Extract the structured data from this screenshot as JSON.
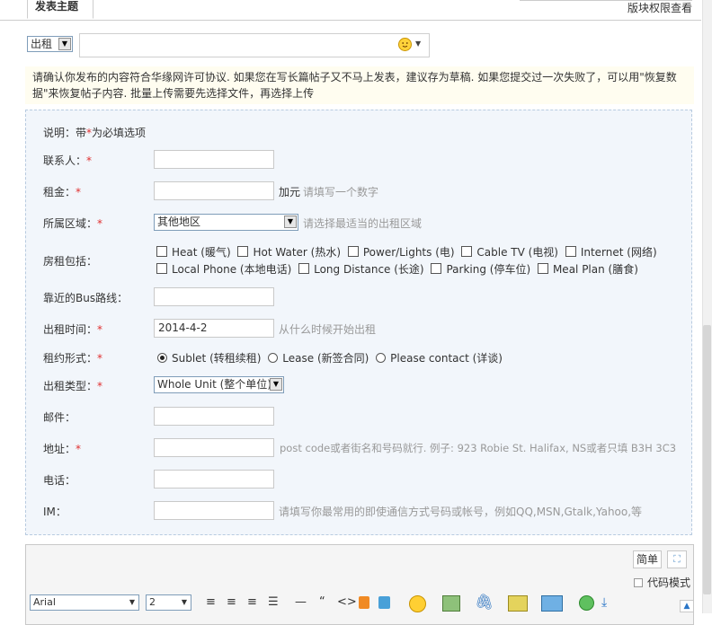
{
  "header": {
    "tab_label": "发表主题",
    "right_text": "版块权限查看"
  },
  "post": {
    "type_value": "出租",
    "title_value": ""
  },
  "notice": "请确认你发布的内容符合华缘网许可协议. 如果您在写长篇帖子又不马上发表，建议存为草稿. 如果您提交过一次失败了，可以用\"恢复数据\"来恢复帖子内容. 批量上传需要先选择文件，再选择上传",
  "form": {
    "note_prefix": "说明：带",
    "note_star": "*",
    "note_suffix": "为必填选项",
    "star": "*",
    "contact": {
      "label": "联系人：",
      "value": ""
    },
    "rent": {
      "label": "租金：",
      "value": "",
      "unit": "加元",
      "hint": "请填写一个数字"
    },
    "area": {
      "label": "所属区域：",
      "value": "其他地区",
      "hint": "请选择最适当的出租区域"
    },
    "includes": {
      "label": "房租包括：",
      "row1": [
        "Heat (暖气)",
        "Hot Water (热水)",
        "Power/Lights (电)",
        "Cable TV (电视)",
        "Internet (网络)"
      ],
      "row2": [
        "Local Phone (本地电话)",
        "Long Distance (长途)",
        "Parking (停车位)",
        "Meal Plan (膳食)"
      ]
    },
    "bus": {
      "label": "靠近的Bus路线：",
      "value": ""
    },
    "date": {
      "label": "出租时间：",
      "value": "2014-4-2",
      "hint": "从什么时候开始出租"
    },
    "lease": {
      "label": "租约形式：",
      "options": [
        "Sublet (转租续租)",
        "Lease (新签合同)",
        "Please contact (详谈)"
      ],
      "selected": 0
    },
    "kind": {
      "label": "出租类型：",
      "value": "Whole Unit (整个单位)"
    },
    "email": {
      "label": "邮件：",
      "value": ""
    },
    "address": {
      "label": "地址：",
      "value": "",
      "hint": "post code或者街名和号码就行. 例子: 923 Robie St. Halifax, NS或者只填 B3H 3C3"
    },
    "phone": {
      "label": "电话：",
      "value": ""
    },
    "im": {
      "label": "IM：",
      "value": "",
      "hint": "请填写你最常用的即使通信方式号码或帐号，例如QQ,MSN,Gtalk,Yahoo,等"
    }
  },
  "editor": {
    "simple_label": "简单",
    "code_mode_label": "代码模式",
    "font": "Arial",
    "size": "2",
    "symbols": {
      "hr": "—",
      "quote": "“",
      "code": "<>"
    }
  }
}
